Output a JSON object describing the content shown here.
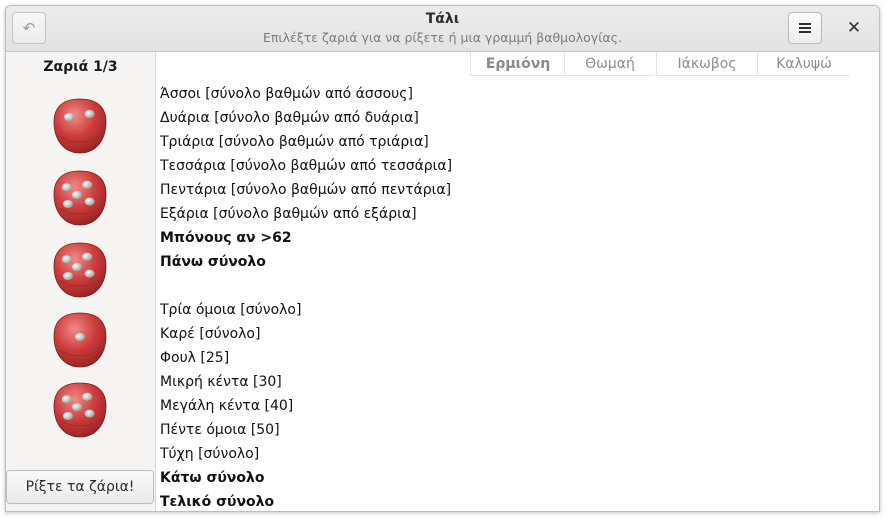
{
  "header": {
    "title": "Τάλι",
    "subtitle": "Επιλέξτε ζαριά για να ρίξετε ή μια γραμμή βαθμολογίας.",
    "undo_icon": "undo-icon",
    "menu_icon": "hamburger-menu-icon",
    "close_label": "✕"
  },
  "sidebar": {
    "dice_label": "Ζαριά 1/3",
    "dice_values": [
      2,
      5,
      5,
      1,
      5
    ],
    "die_color": "#cc3b3b",
    "roll_button": "Ρίξτε τα ζάρια!"
  },
  "players": [
    "Ερμιόνη",
    "Θωμαή",
    "Ιάκωβος",
    "Καλυψώ"
  ],
  "active_player": 0,
  "score_rows": [
    {
      "label": "Άσσοι [σύνολο βαθμών από άσσους]",
      "bold": false
    },
    {
      "label": "Δυάρια [σύνολο βαθμών από δυάρια]",
      "bold": false
    },
    {
      "label": "Τριάρια [σύνολο βαθμών από τριάρια]",
      "bold": false
    },
    {
      "label": "Τεσσάρια [σύνολο βαθμών από τεσσάρια]",
      "bold": false
    },
    {
      "label": "Πεντάρια [σύνολο βαθμών από πεντάρια]",
      "bold": false
    },
    {
      "label": "Εξάρια [σύνολο βαθμών από εξάρια]",
      "bold": false
    },
    {
      "label": "Μπόνους αν >62",
      "bold": true
    },
    {
      "label": "Πάνω σύνολο",
      "bold": true
    },
    {
      "label": "",
      "bold": false
    },
    {
      "label": "Τρία όμοια [σύνολο]",
      "bold": false
    },
    {
      "label": "Καρέ [σύνολο]",
      "bold": false
    },
    {
      "label": "Φουλ [25]",
      "bold": false
    },
    {
      "label": "Μικρή κέντα [30]",
      "bold": false
    },
    {
      "label": "Μεγάλη κέντα [40]",
      "bold": false
    },
    {
      "label": "Πέντε όμοια [50]",
      "bold": false
    },
    {
      "label": "Τύχη [σύνολο]",
      "bold": false
    },
    {
      "label": "Κάτω σύνολο",
      "bold": true
    },
    {
      "label": "Τελικό σύνολο",
      "bold": true
    }
  ]
}
